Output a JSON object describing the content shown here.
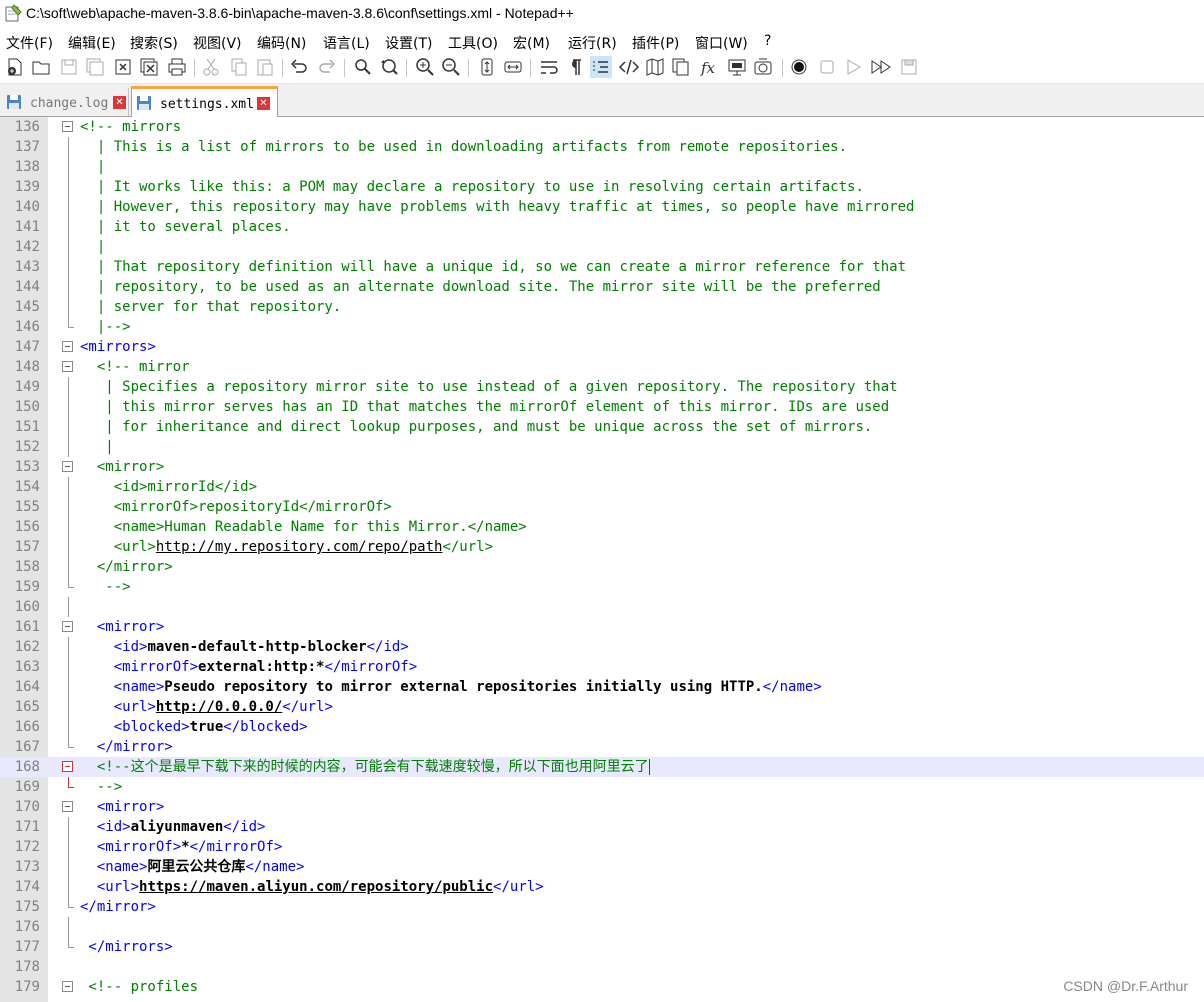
{
  "window": {
    "title": "C:\\soft\\web\\apache-maven-3.8.6-bin\\apache-maven-3.8.6\\conf\\settings.xml - Notepad++"
  },
  "menu": [
    "文件(F)",
    "编辑(E)",
    "搜索(S)",
    "视图(V)",
    "编码(N)",
    "语言(L)",
    "设置(T)",
    "工具(O)",
    "宏(M)",
    "运行(R)",
    "插件(P)",
    "窗口(W)",
    "?"
  ],
  "toolbar_icons": [
    "new-file-icon",
    "open-file-icon",
    "save-icon",
    "save-all-icon",
    "close-icon",
    "close-all-icon",
    "print-icon",
    "cut-icon",
    "copy-icon",
    "paste-icon",
    "undo-icon",
    "redo-icon",
    "find-icon",
    "replace-icon",
    "zoom-in-icon",
    "zoom-out-icon",
    "sync-vertical-icon",
    "sync-horizontal-icon",
    "word-wrap-icon",
    "show-all-chars-icon",
    "indent-guide-icon",
    "xml-tag-icon",
    "document-map-icon",
    "document-list-icon",
    "function-list-icon",
    "folder-as-workspace-icon",
    "monitoring-icon",
    "record-macro-icon",
    "stop-record-icon",
    "play-macro-icon",
    "run-macro-multiple-icon",
    "save-macro-icon"
  ],
  "tabs": [
    {
      "label": "change.log",
      "active": false
    },
    {
      "label": "settings.xml",
      "active": true
    }
  ],
  "colors": {
    "comment": "#008000",
    "tag": "#0000ff",
    "gutter": "#e4e4e4",
    "current_line": "#e8e8ff",
    "active_tab_accent": "#f9a640"
  },
  "lines": [
    {
      "n": "136",
      "s": [
        {
          "c": "cmt",
          "t": "<!-- mirrors"
        }
      ]
    },
    {
      "n": "137",
      "s": [
        {
          "c": "cmt",
          "t": "  | This is a list of mirrors to be used in downloading artifacts from remote repositories."
        }
      ]
    },
    {
      "n": "138",
      "s": [
        {
          "c": "cmt",
          "t": "  |"
        }
      ]
    },
    {
      "n": "139",
      "s": [
        {
          "c": "cmt",
          "t": "  | It works like this: a POM may declare a repository to use in resolving certain artifacts."
        }
      ]
    },
    {
      "n": "140",
      "s": [
        {
          "c": "cmt",
          "t": "  | However, this repository may have problems with heavy traffic at times, so people have mirrored"
        }
      ]
    },
    {
      "n": "141",
      "s": [
        {
          "c": "cmt",
          "t": "  | it to several places."
        }
      ]
    },
    {
      "n": "142",
      "s": [
        {
          "c": "cmt",
          "t": "  |"
        }
      ]
    },
    {
      "n": "143",
      "s": [
        {
          "c": "cmt",
          "t": "  | That repository definition will have a unique id, so we can create a mirror reference for that"
        }
      ]
    },
    {
      "n": "144",
      "s": [
        {
          "c": "cmt",
          "t": "  | repository, to be used as an alternate download site. The mirror site will be the preferred"
        }
      ]
    },
    {
      "n": "145",
      "s": [
        {
          "c": "cmt",
          "t": "  | server for that repository."
        }
      ]
    },
    {
      "n": "146",
      "s": [
        {
          "c": "cmt",
          "t": "  |-->"
        }
      ]
    },
    {
      "n": "147",
      "s": [
        {
          "c": "tag",
          "t": "<mirrors>"
        }
      ]
    },
    {
      "n": "148",
      "s": [
        {
          "c": "cmt",
          "t": "  <!-- mirror"
        }
      ]
    },
    {
      "n": "149",
      "s": [
        {
          "c": "cmt",
          "t": "   | Specifies a repository mirror site to use instead of a given repository. The repository that"
        }
      ]
    },
    {
      "n": "150",
      "s": [
        {
          "c": "cmt",
          "t": "   | this mirror serves has an ID that matches the mirrorOf element of this mirror. IDs are used"
        }
      ]
    },
    {
      "n": "151",
      "s": [
        {
          "c": "cmt",
          "t": "   | for inheritance and direct lookup purposes, and must be unique across the set of mirrors."
        }
      ]
    },
    {
      "n": "152",
      "s": [
        {
          "c": "cmt",
          "t": "   |"
        }
      ]
    },
    {
      "n": "153",
      "s": [
        {
          "c": "cmt",
          "t": "  <mirror>"
        }
      ]
    },
    {
      "n": "154",
      "s": [
        {
          "c": "cmt",
          "t": "    <id>mirrorId</id>"
        }
      ]
    },
    {
      "n": "155",
      "s": [
        {
          "c": "cmt",
          "t": "    <mirrorOf>repositoryId</mirrorOf>"
        }
      ]
    },
    {
      "n": "156",
      "s": [
        {
          "c": "cmt",
          "t": "    <name>Human Readable Name for this Mirror.</name>"
        }
      ]
    },
    {
      "n": "157",
      "s": [
        {
          "c": "cmt",
          "t": "    <url>"
        },
        {
          "c": "cmt url-c",
          "t": "http://my.repository.com/repo/path"
        },
        {
          "c": "cmt",
          "t": "</url>"
        }
      ]
    },
    {
      "n": "158",
      "s": [
        {
          "c": "cmt",
          "t": "  </mirror>"
        }
      ]
    },
    {
      "n": "159",
      "s": [
        {
          "c": "cmt",
          "t": "   -->"
        }
      ]
    },
    {
      "n": "160",
      "s": []
    },
    {
      "n": "161",
      "s": [
        {
          "c": "tag",
          "t": "  <mirror>"
        }
      ]
    },
    {
      "n": "162",
      "s": [
        {
          "c": "tag",
          "t": "    <id>"
        },
        {
          "c": "txt",
          "t": "maven-default-http-blocker"
        },
        {
          "c": "tag",
          "t": "</id>"
        }
      ]
    },
    {
      "n": "163",
      "s": [
        {
          "c": "tag",
          "t": "    <mirrorOf>"
        },
        {
          "c": "txt",
          "t": "external:http:*"
        },
        {
          "c": "tag",
          "t": "</mirrorOf>"
        }
      ]
    },
    {
      "n": "164",
      "s": [
        {
          "c": "tag",
          "t": "    <name>"
        },
        {
          "c": "txt",
          "t": "Pseudo repository to mirror external repositories initially using HTTP."
        },
        {
          "c": "tag",
          "t": "</name>"
        }
      ]
    },
    {
      "n": "165",
      "s": [
        {
          "c": "tag",
          "t": "    <url>"
        },
        {
          "c": "urlb",
          "t": "http://0.0.0.0/"
        },
        {
          "c": "tag",
          "t": "</url>"
        }
      ]
    },
    {
      "n": "166",
      "s": [
        {
          "c": "tag",
          "t": "    <blocked>"
        },
        {
          "c": "txt",
          "t": "true"
        },
        {
          "c": "tag",
          "t": "</blocked>"
        }
      ]
    },
    {
      "n": "167",
      "s": [
        {
          "c": "tag",
          "t": "  </mirror>"
        }
      ]
    },
    {
      "n": "168",
      "s": [
        {
          "c": "cmt",
          "t": "  <!--"
        },
        {
          "c": "cmt cjk",
          "t": "这个是最早下载下来的时候的内容，可能会有下载速度较慢，所以下面也用阿里云了"
        }
      ],
      "current": true
    },
    {
      "n": "169",
      "s": [
        {
          "c": "cmt",
          "t": "  -->"
        }
      ]
    },
    {
      "n": "170",
      "s": [
        {
          "c": "tag",
          "t": "  <mirror>"
        }
      ]
    },
    {
      "n": "171",
      "s": [
        {
          "c": "tag",
          "t": "  <id>"
        },
        {
          "c": "txt",
          "t": "aliyunmaven"
        },
        {
          "c": "tag",
          "t": "</id>"
        }
      ]
    },
    {
      "n": "172",
      "s": [
        {
          "c": "tag",
          "t": "  <mirrorOf>"
        },
        {
          "c": "txt",
          "t": "*"
        },
        {
          "c": "tag",
          "t": "</mirrorOf>"
        }
      ]
    },
    {
      "n": "173",
      "s": [
        {
          "c": "tag",
          "t": "  <name>"
        },
        {
          "c": "txt cjk",
          "t": "阿里云公共仓库"
        },
        {
          "c": "tag",
          "t": "</name>"
        }
      ]
    },
    {
      "n": "174",
      "s": [
        {
          "c": "tag",
          "t": "  <url>"
        },
        {
          "c": "urlb",
          "t": "https://maven.aliyun.com/repository/public"
        },
        {
          "c": "tag",
          "t": "</url>"
        }
      ]
    },
    {
      "n": "175",
      "s": [
        {
          "c": "tag",
          "t": "</mirror>"
        }
      ]
    },
    {
      "n": "176",
      "s": []
    },
    {
      "n": "177",
      "s": [
        {
          "c": "tag",
          "t": " </mirrors>"
        }
      ]
    },
    {
      "n": "178",
      "s": []
    },
    {
      "n": "179",
      "s": [
        {
          "c": "cmt",
          "t": " <!-- profiles"
        }
      ]
    }
  ],
  "watermark": "CSDN @Dr.F.Arthur"
}
